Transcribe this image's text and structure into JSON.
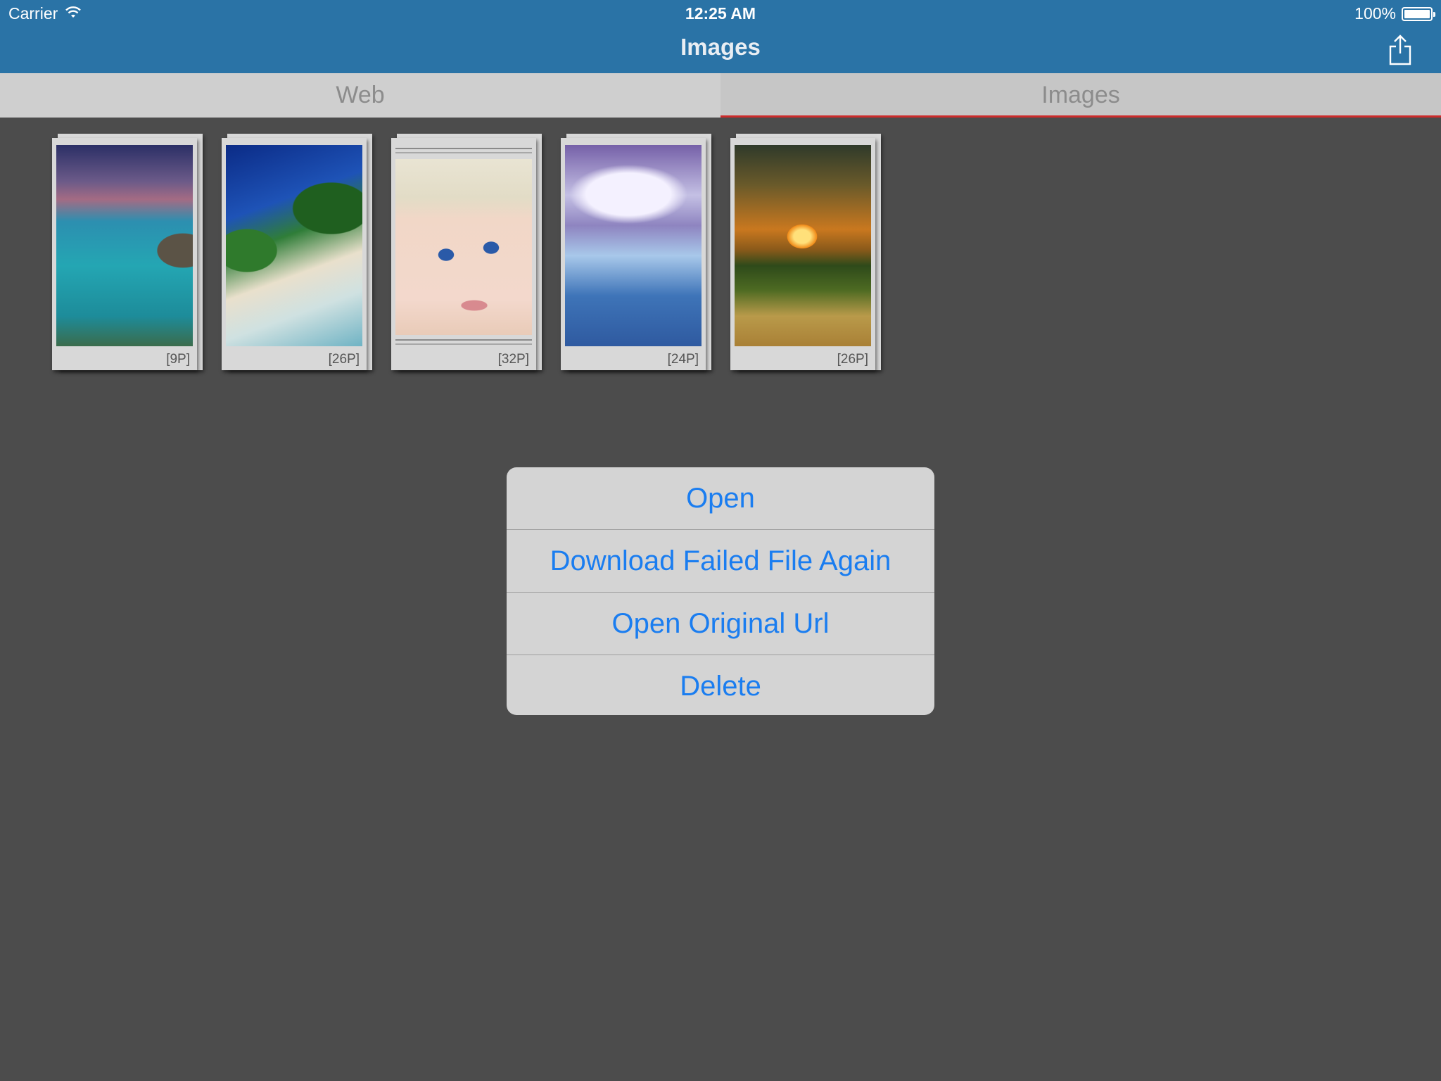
{
  "status_bar": {
    "carrier": "Carrier",
    "time": "12:25 AM",
    "battery": "100%"
  },
  "nav": {
    "title": "Images",
    "share_icon": "share-icon"
  },
  "tabs": [
    {
      "label": "Web",
      "active": false
    },
    {
      "label": "Images",
      "active": true
    }
  ],
  "albums": [
    {
      "count": "[9P]",
      "thumbnail": "sea-cliffs"
    },
    {
      "count": "[26P]",
      "thumbnail": "tropical-beach"
    },
    {
      "count": "[32P]",
      "thumbnail": "baby-portrait"
    },
    {
      "count": "[24P]",
      "thumbnail": "sky-clouds"
    },
    {
      "count": "[26P]",
      "thumbnail": "sunset-field"
    }
  ],
  "action_sheet": {
    "items": [
      {
        "label": "Open"
      },
      {
        "label": "Download Failed File Again"
      },
      {
        "label": "Open Original Url"
      },
      {
        "label": "Delete"
      }
    ]
  },
  "colors": {
    "nav_bar": "#2a73a6",
    "background": "#4c4c4c",
    "tab_indicator": "#cc2b2b",
    "action_text": "#1a7df0"
  }
}
